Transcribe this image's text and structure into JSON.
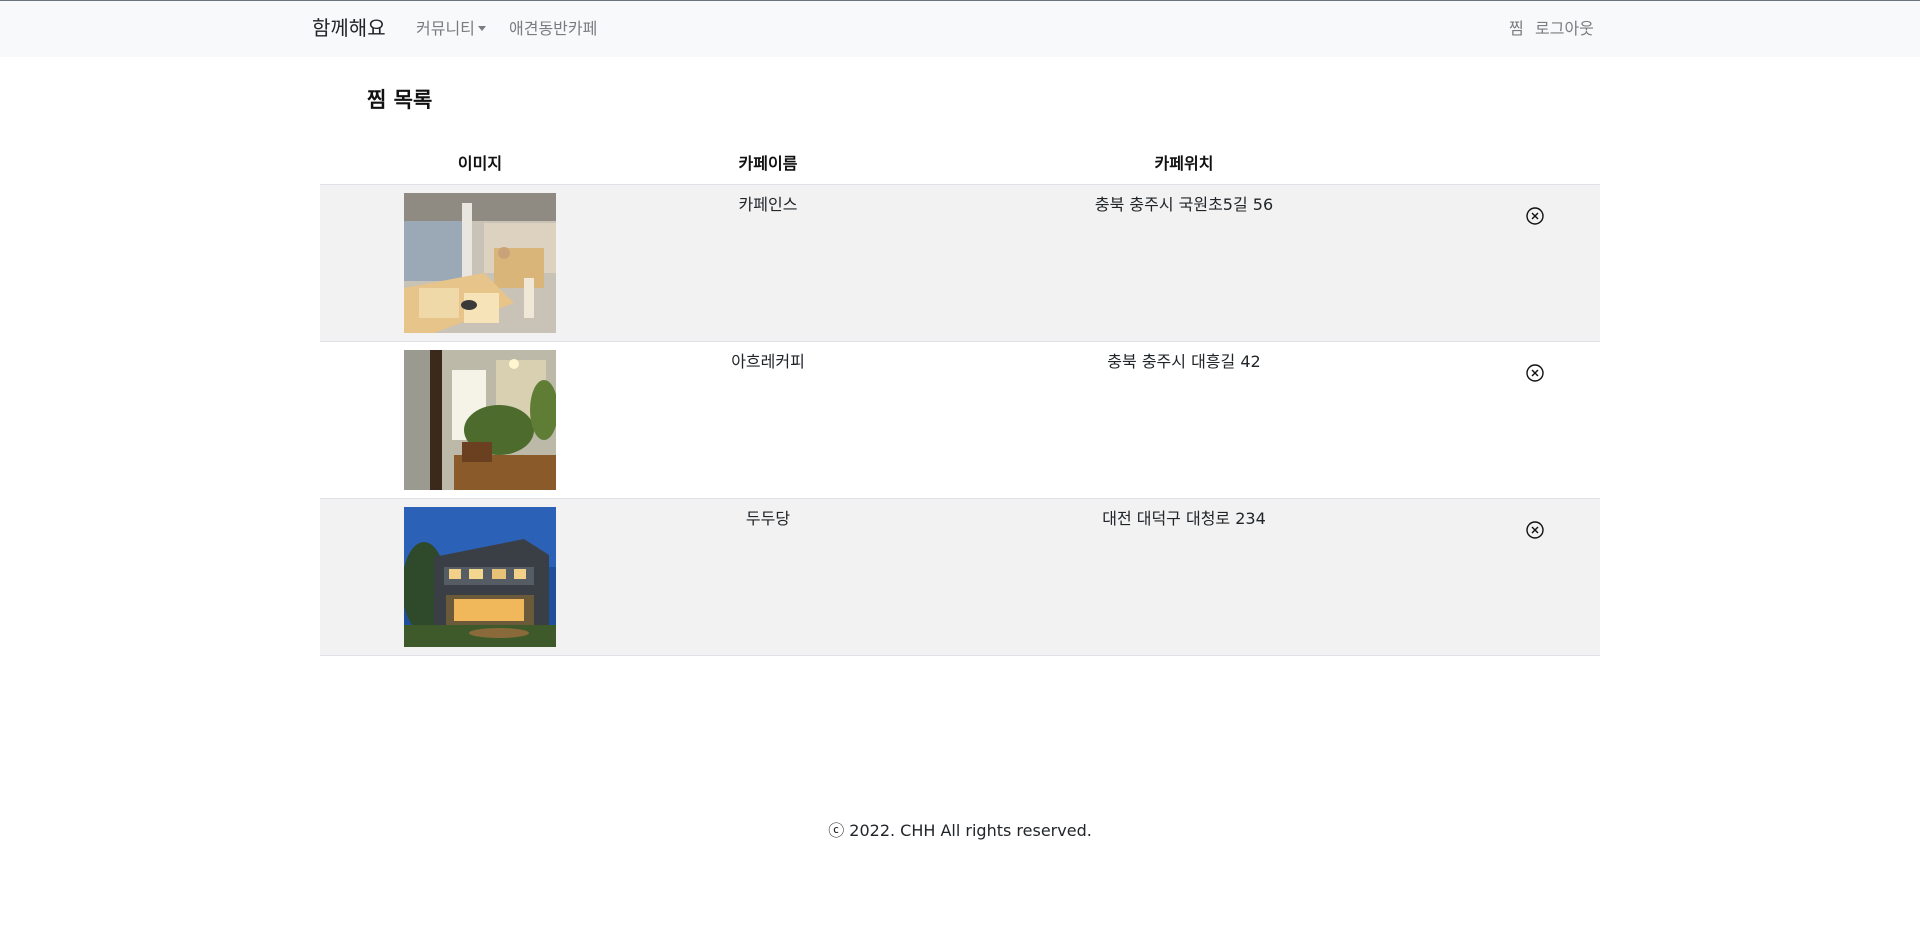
{
  "navbar": {
    "brand": "함께해요",
    "community": "커뮤니티",
    "pet_cafe": "애견동반카페",
    "wish": "찜",
    "logout": "로그아웃"
  },
  "page": {
    "title": "찜 목록"
  },
  "table": {
    "headers": [
      "이미지",
      "카페이름",
      "카페위치",
      ""
    ],
    "rows": [
      {
        "name": "카페인스",
        "location": "충북 충주시 국원초5길 56",
        "image": "cafe-interior-photo"
      },
      {
        "name": "아흐레커피",
        "location": "충북 충주시 대흥길 42",
        "image": "cafe-plants-photo"
      },
      {
        "name": "두두당",
        "location": "대전 대덕구 대청로 234",
        "image": "cafe-building-night-photo"
      }
    ]
  },
  "footer": {
    "copyright": "ⓒ 2022. CHH All rights reserved."
  },
  "colors": {
    "navbar_bg": "#f8f9fa",
    "stripe": "#f2f2f2",
    "nav_link": "#7a7d80",
    "border": "#dee2e6"
  }
}
